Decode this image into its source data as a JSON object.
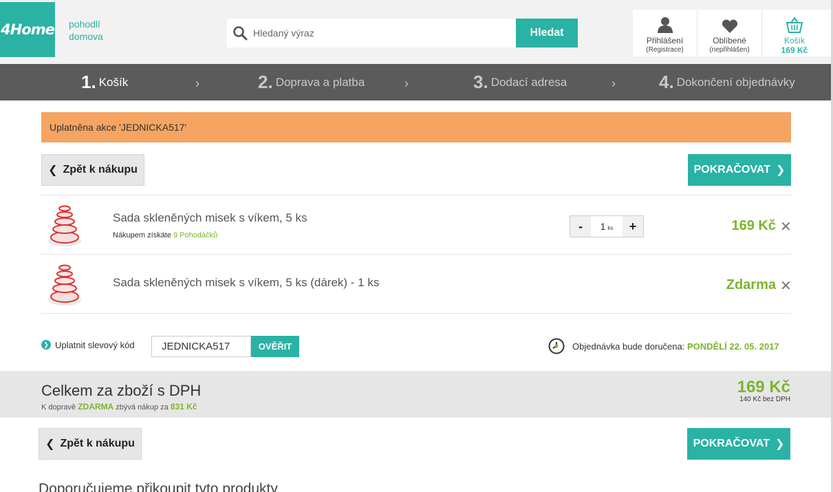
{
  "header": {
    "logo": "4Home",
    "tagline": [
      "pohodlí",
      "domova"
    ],
    "search": {
      "placeholder": "Hledaný výraz",
      "button": "Hledat"
    },
    "tiles": {
      "login": {
        "label": "Přihlášení",
        "sub": "(Registrace)",
        "icon": "user-icon"
      },
      "favorites": {
        "label": "Oblíbené",
        "sub": "(nepřihlášen)",
        "icon": "heart-icon"
      },
      "cart": {
        "label": "Košík",
        "sub": "169 Kč",
        "icon": "basket-icon"
      }
    }
  },
  "steps": [
    {
      "num": "1.",
      "label": "Košík",
      "active": true
    },
    {
      "num": "2.",
      "label": "Doprava a platba",
      "active": false
    },
    {
      "num": "3.",
      "label": "Dodací adresa",
      "active": false
    },
    {
      "num": "4.",
      "label": "Dokončení objednávky",
      "active": false
    }
  ],
  "promo": "Uplatněna akce 'JEDNICKA517'",
  "buttons": {
    "back": "Zpět k nákupu",
    "continue": "POKRAČOVAT"
  },
  "items": [
    {
      "name": "Sada skleněných misek s víkem, 5 ks",
      "bonus_prefix": "Nákupem získáte ",
      "bonus_points": "9 Pohodáčků",
      "qty": "1",
      "qty_unit": "ks",
      "price": "169 Kč"
    },
    {
      "name": "Sada skleněných misek s víkem, 5 ks (dárek) - 1 ks",
      "price": "Zdarma"
    }
  ],
  "coupon": {
    "label": "Uplatnit slevový kód",
    "value": "JEDNICKA517",
    "button": "OVĚŘIT"
  },
  "delivery": {
    "label": "Objednávka bude doručena: ",
    "date": "PONDĚLÍ 22. 05. 2017"
  },
  "total": {
    "label": "Celkem za zboží s DPH",
    "price": "169 Kč",
    "net": "140 Kč bez DPH",
    "shipping_prefix": "K dopravě ",
    "shipping_free": "ZDARMA",
    "shipping_mid": " zbývá nákup za ",
    "shipping_amount": "831 Kč"
  },
  "recommend_title": "Doporučujeme přikoupit tyto produkty",
  "colors": {
    "brand": "#2ab2a5",
    "price": "#7bb52d",
    "promo": "#f5a461",
    "steps_bg": "#5b5b5b"
  }
}
